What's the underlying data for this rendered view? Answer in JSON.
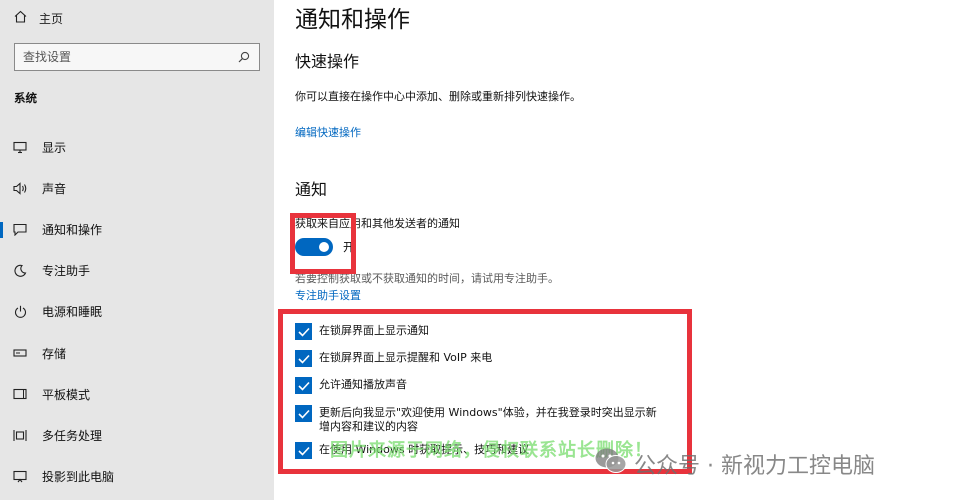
{
  "sidebar": {
    "home_label": "主页",
    "search_placeholder": "查找设置",
    "section_label": "系统",
    "items": [
      {
        "label": "显示",
        "icon": "monitor-icon"
      },
      {
        "label": "声音",
        "icon": "speaker-icon"
      },
      {
        "label": "通知和操作",
        "icon": "notification-icon",
        "active": true
      },
      {
        "label": "专注助手",
        "icon": "moon-icon"
      },
      {
        "label": "电源和睡眠",
        "icon": "power-icon"
      },
      {
        "label": "存储",
        "icon": "storage-icon"
      },
      {
        "label": "平板模式",
        "icon": "tablet-icon"
      },
      {
        "label": "多任务处理",
        "icon": "multitask-icon"
      },
      {
        "label": "投影到此电脑",
        "icon": "project-icon"
      }
    ]
  },
  "main": {
    "title": "通知和操作",
    "quick_actions": {
      "heading": "快速操作",
      "description": "你可以直接在操作中心中添加、删除或重新排列快速操作。",
      "edit_link": "编辑快速操作"
    },
    "notifications": {
      "heading": "通知",
      "toggle_caption": "获取来自应用和其他发送者的通知",
      "toggle_state": "开",
      "toggle_on": true,
      "focus_hint": "若要控制获取或不获取通知的时间，请试用专注助手。",
      "focus_link": "专注助手设置",
      "checkboxes": [
        {
          "label": "在锁屏界面上显示通知",
          "checked": true
        },
        {
          "label": "在锁屏界面上显示提醒和 VoIP 来电",
          "checked": true
        },
        {
          "label": "允许通知播放声音",
          "checked": true
        },
        {
          "label": "更新后向我显示\"欢迎使用 Windows\"体验，并在我登录时突出显示新增内容和建议的内容",
          "checked": true
        },
        {
          "label": "在使用 Windows 时获取提示、技巧和建议",
          "checked": true
        }
      ]
    }
  },
  "overlays": {
    "watermark_green": "图片来源于网络，侵权联系站长删除！",
    "watermark_gray": "公众号 · 新视力工控电脑"
  },
  "colors": {
    "accent": "#0067c0",
    "highlight_box": "#e8333c",
    "sidebar_bg": "#e6e6e6"
  }
}
